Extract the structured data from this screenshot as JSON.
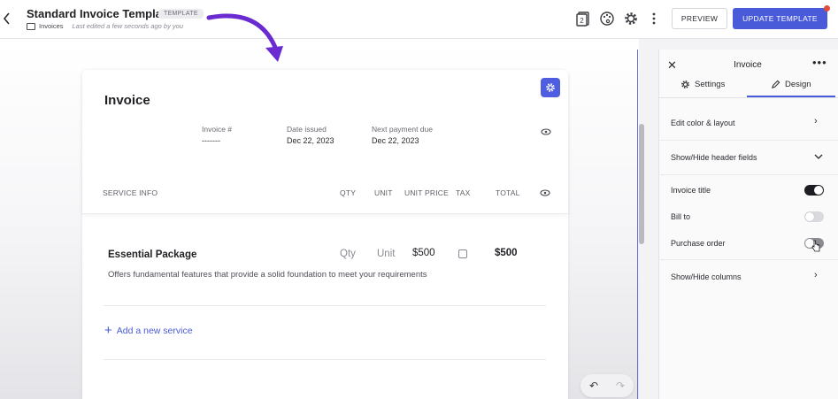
{
  "header": {
    "title": "Standard Invoice Template",
    "badge": "TEMPLATE",
    "breadcrumb": "Invoices",
    "edited": "Last edited a few seconds ago by you",
    "page_count": "2",
    "preview_label": "PREVIEW",
    "update_label": "UPDATE TEMPLATE"
  },
  "invoice": {
    "title": "Invoice",
    "fields": [
      {
        "label": "Invoice #",
        "value": "-------"
      },
      {
        "label": "Date issued",
        "value": "Dec 22, 2023"
      },
      {
        "label": "Next payment due",
        "value": "Dec 22, 2023"
      }
    ],
    "columns": {
      "service": "SERVICE INFO",
      "qty": "QTY",
      "unit": "UNIT",
      "unit_price": "UNIT PRICE",
      "tax": "TAX",
      "total": "TOTAL"
    },
    "item": {
      "name": "Essential Package",
      "description": "Offers fundamental features that provide a solid foundation to meet your requirements",
      "qty": "Qty",
      "unit": "Unit",
      "price": "$500",
      "total": "$500",
      "tax_checked": false
    },
    "add_service": "Add a new service"
  },
  "panel": {
    "title": "Invoice",
    "tabs": {
      "settings": "Settings",
      "design": "Design"
    },
    "active_tab": "Design",
    "edit_color": "Edit color & layout",
    "header_fields": "Show/Hide header fields",
    "toggles": [
      {
        "label": "Invoice title",
        "on": true
      },
      {
        "label": "Bill to",
        "on": false
      },
      {
        "label": "Purchase order",
        "on": false
      }
    ],
    "columns": "Show/Hide columns"
  },
  "colors": {
    "accent": "#4a5bd9",
    "annotation_arrow": "#6a2bd1"
  },
  "icons": [
    "chevron-left-icon",
    "folder-icon",
    "pages-icon",
    "palette-icon",
    "gear-icon",
    "kebab-icon",
    "eye-icon",
    "plus-icon",
    "undo-icon",
    "redo-icon",
    "close-icon",
    "pencil-icon",
    "chevron-right-icon",
    "chevron-down-icon"
  ]
}
